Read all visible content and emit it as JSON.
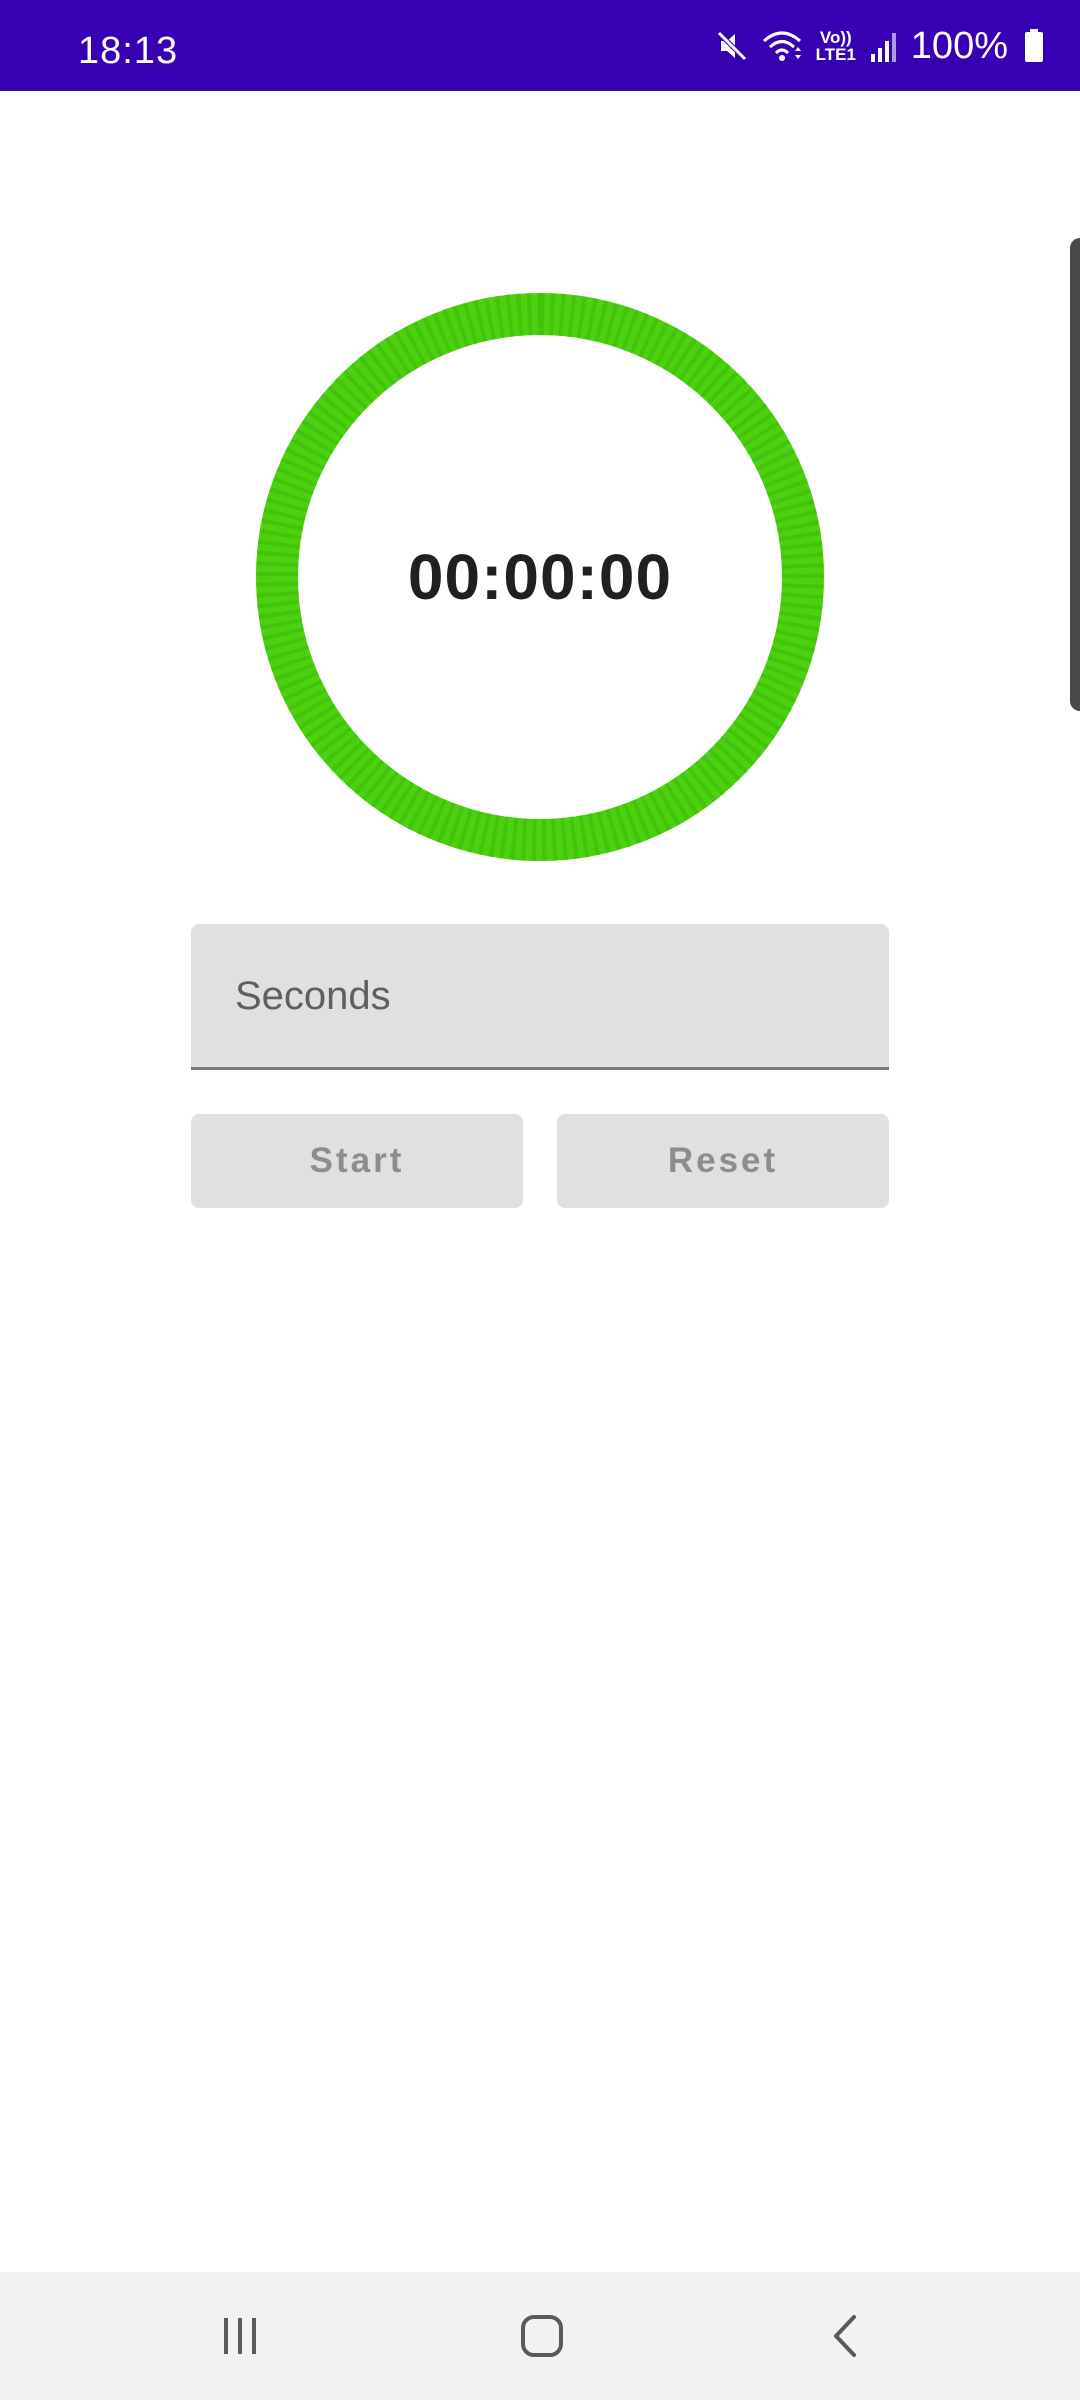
{
  "status_bar": {
    "time": "18:13",
    "network_label": "Vo)) LTE1",
    "battery_percent": "100%",
    "icons": [
      "mute-icon",
      "wifi-icon",
      "lte-icon",
      "signal-icon",
      "battery-icon"
    ]
  },
  "timer": {
    "display": "00:00:00",
    "ring_color": "#4cd10f",
    "ring_progress": 1.0
  },
  "seconds_input": {
    "placeholder": "Seconds",
    "value": ""
  },
  "buttons": {
    "start_label": "Start",
    "reset_label": "Reset"
  },
  "nav_bar": {
    "icons": [
      "recents-icon",
      "home-icon",
      "back-icon"
    ]
  },
  "colors": {
    "status_bar": "#3700b3",
    "ring": "#4cd10f",
    "field_bg": "#e0e0e0"
  }
}
